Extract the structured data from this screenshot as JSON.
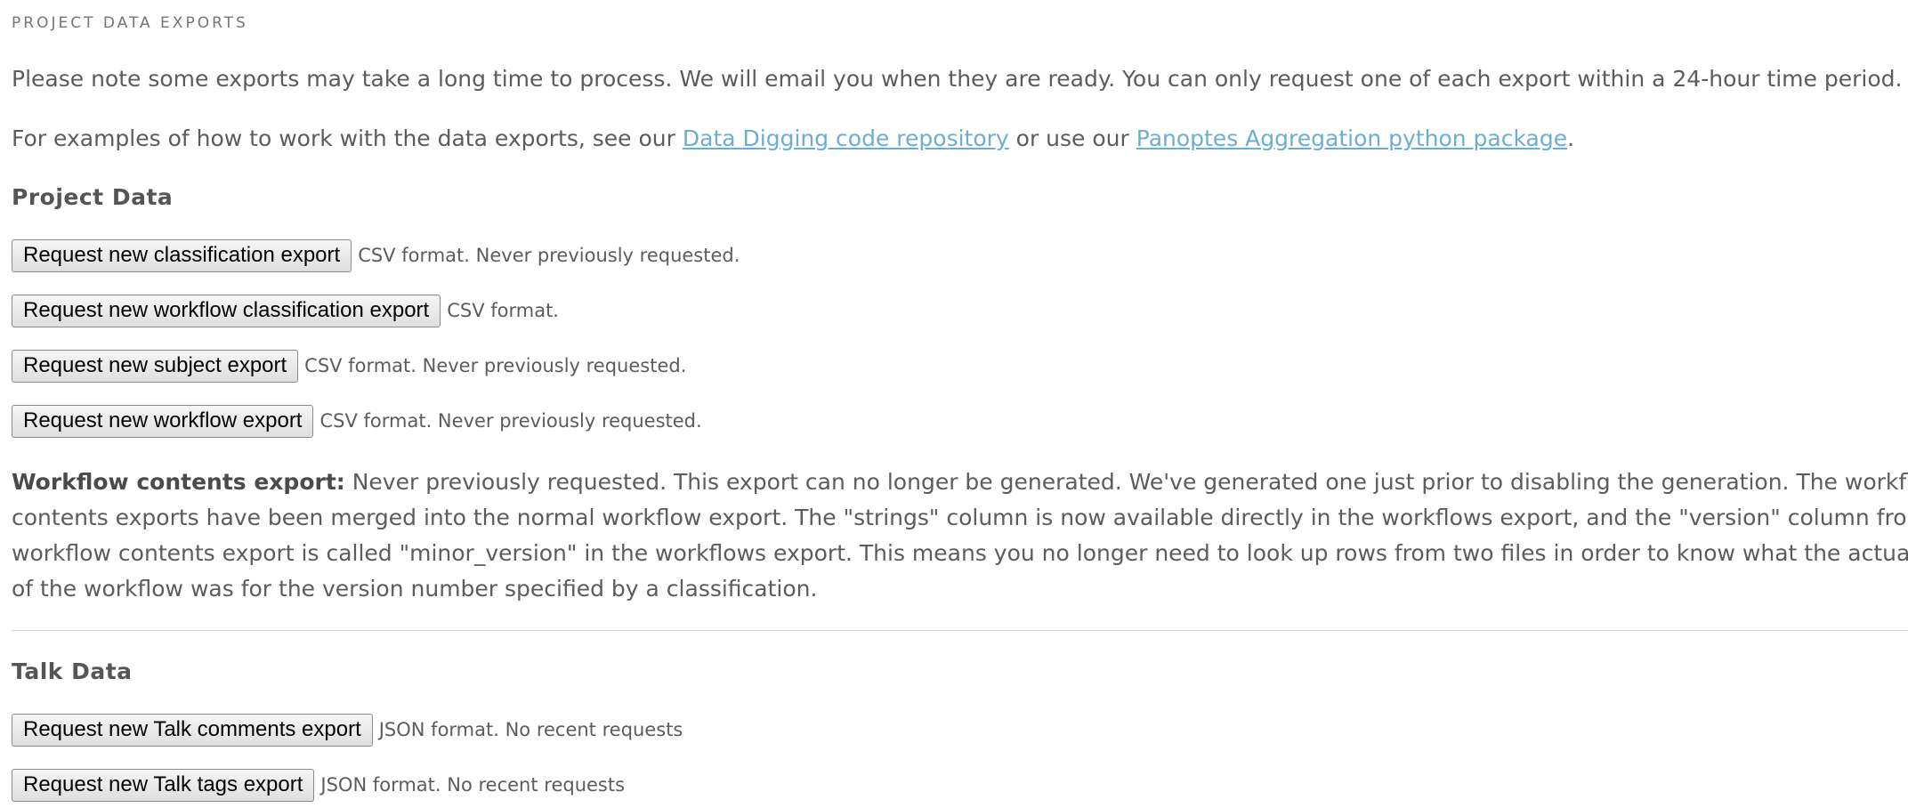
{
  "header": {
    "title": "PROJECT DATA EXPORTS"
  },
  "intro": {
    "note": "Please note some exports may take a long time to process. We will email you when they are ready. You can only request one of each export within a 24-hour time period.",
    "examples_prefix": "For examples of how to work with the data exports, see our ",
    "link1": "Data Digging code repository",
    "examples_middle": " or use our ",
    "link2": "Panoptes Aggregation python package",
    "examples_suffix": "."
  },
  "project_data": {
    "heading": "Project Data",
    "exports": [
      {
        "button": "Request new classification export",
        "note": "CSV format. Never previously requested."
      },
      {
        "button": "Request new workflow classification export",
        "note": "CSV format."
      },
      {
        "button": "Request new subject export",
        "note": "CSV format. Never previously requested."
      },
      {
        "button": "Request new workflow export",
        "note": "CSV format. Never previously requested."
      }
    ]
  },
  "workflow_contents": {
    "label": "Workflow contents export:",
    "line1": " Never previously requested. This export can no longer be generated. We've generated one just prior to disabling the generation. The workflow",
    "line2": "contents exports have been merged into the normal workflow export. The \"strings\" column is now available directly in the workflows export, and the \"version\" column from the",
    "line3": "workflow contents export is called \"minor_version\" in the workflows export. This means you no longer need to look up rows from two files in order to know what the actual set",
    "line4": "of the workflow was for the version number specified by a classification."
  },
  "talk_data": {
    "heading": "Talk Data",
    "exports": [
      {
        "button": "Request new Talk comments export",
        "note": "JSON format. No recent requests"
      },
      {
        "button": "Request new Talk tags export",
        "note": "JSON format. No recent requests"
      }
    ]
  }
}
